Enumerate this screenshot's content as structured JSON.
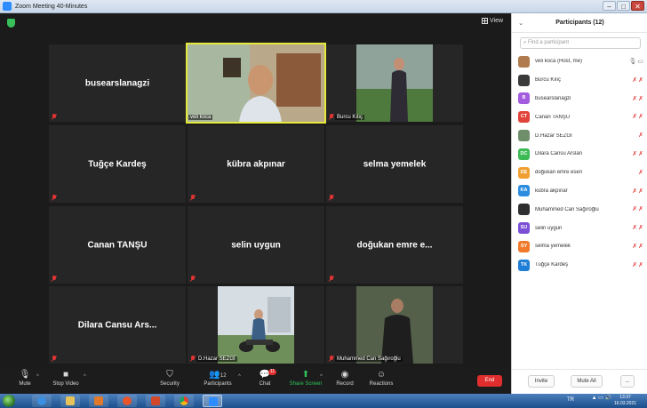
{
  "window": {
    "title": "Zoom Meeting 40-Minutes"
  },
  "view_button": {
    "label": "View"
  },
  "tiles": [
    {
      "name": "busearslanagzi",
      "caption": ""
    },
    {
      "name": "",
      "caption": "veli koca",
      "video": true
    },
    {
      "name": "",
      "caption": "Burcu Kılıç",
      "video": true
    },
    {
      "name": "Tuğçe Kardeş",
      "caption": ""
    },
    {
      "name": "kübra akpınar",
      "caption": ""
    },
    {
      "name": "selma yemelek",
      "caption": ""
    },
    {
      "name": "Canan TANŞU",
      "caption": ""
    },
    {
      "name": "selin uygun",
      "caption": ""
    },
    {
      "name": "doğukan emre e...",
      "caption": ""
    },
    {
      "name": "Dilara Cansu Ars...",
      "caption": ""
    },
    {
      "name": "",
      "caption": "D.Hazar SEZGİ",
      "video": true
    },
    {
      "name": "",
      "caption": "Muhammed Can Sağıroğlu",
      "video": true
    }
  ],
  "toolbar": {
    "mute": "Mute",
    "stop_video": "Stop Video",
    "security": "Security",
    "participants": "Participants",
    "participants_count": "12",
    "chat": "Chat",
    "chat_badge": "11",
    "share_screen": "Share Screen",
    "record": "Record",
    "reactions": "Reactions",
    "end": "End"
  },
  "panel": {
    "title": "Participants (12)",
    "search_placeholder": "Find a participant",
    "invite": "Invite",
    "mute_all": "Mute All",
    "more": "...",
    "participants": [
      {
        "initials": "",
        "name": "veli koca (Host, me)",
        "color": "#b07b4f",
        "muted": false
      },
      {
        "initials": "",
        "name": "Burcu Kılıç",
        "color": "#3a3a3a",
        "muted": true
      },
      {
        "initials": "B",
        "name": "busearslanagzi",
        "color": "#a35be0",
        "muted": true
      },
      {
        "initials": "CT",
        "name": "Canan TANŞU",
        "color": "#e0443a",
        "muted": true
      },
      {
        "initials": "",
        "name": "D.Hazar SEZGİ",
        "color": "#6f8f6a",
        "muted": true
      },
      {
        "initials": "DC",
        "name": "Dilara Cansu Arslan",
        "color": "#3cba54",
        "muted": true
      },
      {
        "initials": "DE",
        "name": "doğukan emre esen",
        "color": "#f0a030",
        "muted": true
      },
      {
        "initials": "KA",
        "name": "kübra akpınar",
        "color": "#2b8ce0",
        "muted": true
      },
      {
        "initials": "",
        "name": "Muhammed Can Sağıroğlu",
        "color": "#2f2f2f",
        "muted": true
      },
      {
        "initials": "SU",
        "name": "selin uygun",
        "color": "#7b4fd6",
        "muted": true
      },
      {
        "initials": "SY",
        "name": "selma yemelek",
        "color": "#f07a2a",
        "muted": true
      },
      {
        "initials": "TK",
        "name": "Tuğçe Kardeş",
        "color": "#1f7ed6",
        "muted": true
      }
    ]
  },
  "taskbar": {
    "language": "TR",
    "time": "13:37",
    "date": "16.03.2021"
  }
}
